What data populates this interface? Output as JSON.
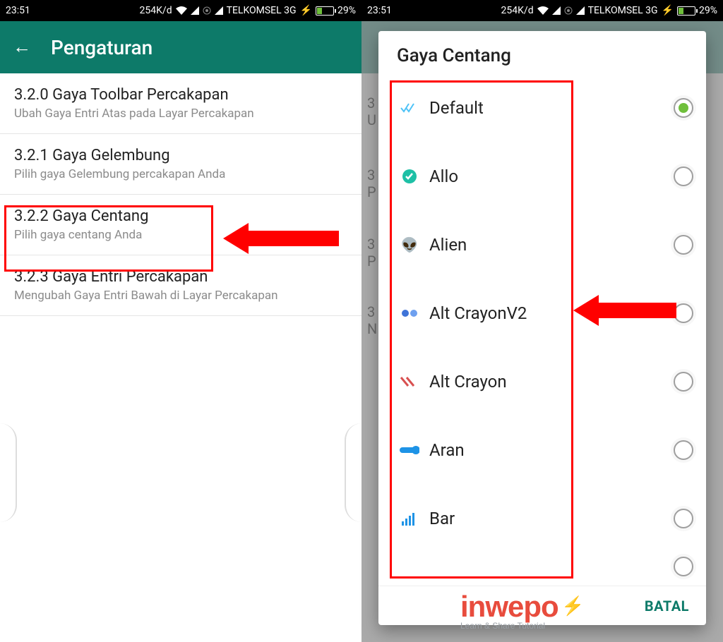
{
  "statusbar": {
    "time": "23:51",
    "speed": "254K/d",
    "carrier": "TELKOMSEL 3G",
    "battery_pct": "29%"
  },
  "screen1": {
    "title": "Pengaturan",
    "items": [
      {
        "title": "3.2.0 Gaya Toolbar Percakapan",
        "sub": "Ubah Gaya Entri Atas pada Layar Percakapan"
      },
      {
        "title": "3.2.1 Gaya Gelembung",
        "sub": "Pilih gaya Gelembung percakapan Anda"
      },
      {
        "title": "3.2.2 Gaya Centang",
        "sub": "Pilih gaya centang Anda"
      },
      {
        "title": "3.2.3 Gaya Entri Percakapan",
        "sub": "Mengubah Gaya Entri Bawah di Layar Percakapan"
      }
    ]
  },
  "dialog": {
    "title": "Gaya Centang",
    "options": [
      {
        "label": "Default",
        "selected": true
      },
      {
        "label": "Allo",
        "selected": false
      },
      {
        "label": "Alien",
        "selected": false
      },
      {
        "label": "Alt CrayonV2",
        "selected": false
      },
      {
        "label": "Alt Crayon",
        "selected": false
      },
      {
        "label": "Aran",
        "selected": false
      },
      {
        "label": "Bar",
        "selected": false
      }
    ],
    "cancel": "BATAL"
  },
  "watermark": {
    "brand": "inwepo",
    "tagline": "Learn & Share Tutorial"
  }
}
